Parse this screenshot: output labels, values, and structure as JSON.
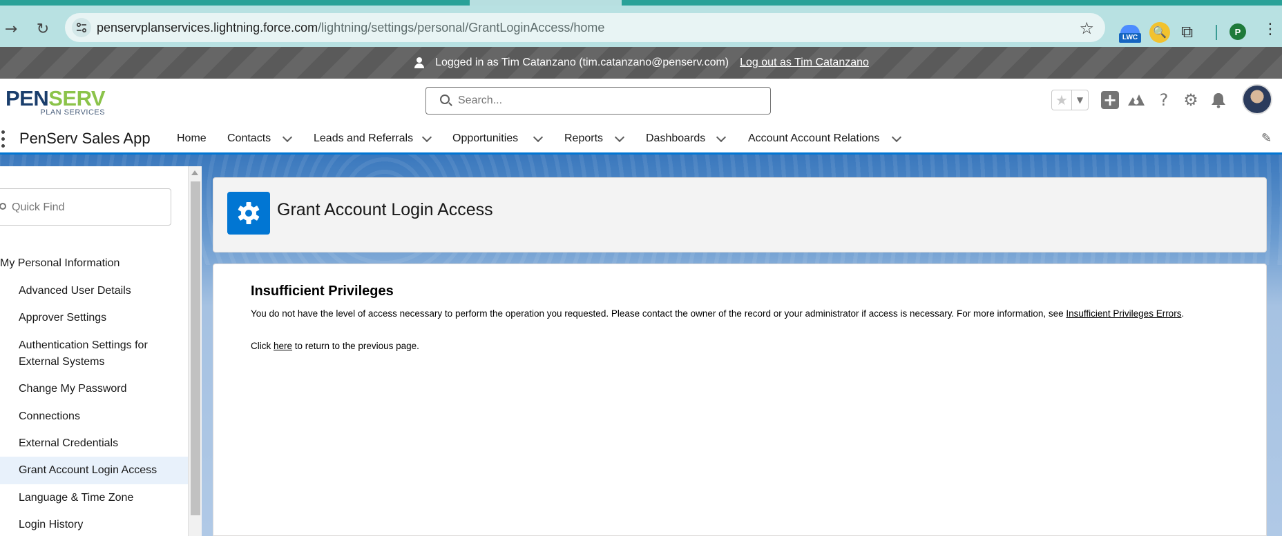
{
  "browser": {
    "url_host": "penservplanservices.lightning.force.com",
    "url_path": "/lightning/settings/personal/GrantLoginAccess/home",
    "extension_lwc_label": "LWC",
    "profile_initial": "P"
  },
  "impersonation": {
    "message": "Logged in as Tim Catanzano (tim.catanzano@penserv.com)",
    "logout_link": "Log out as Tim Catanzano"
  },
  "header": {
    "logo_main_a": "PEN",
    "logo_main_b": "SERV",
    "logo_sub": "PLAN SERVICES",
    "search_placeholder": "Search..."
  },
  "app_nav": {
    "app_name": "PenServ Sales App",
    "items": [
      {
        "label": "Home",
        "has_menu": false
      },
      {
        "label": "Contacts",
        "has_menu": true
      },
      {
        "label": "Leads and Referrals",
        "has_menu": true
      },
      {
        "label": "Opportunities",
        "has_menu": true
      },
      {
        "label": "Reports",
        "has_menu": true
      },
      {
        "label": "Dashboards",
        "has_menu": true
      },
      {
        "label": "Account Account Relations",
        "has_menu": true
      }
    ]
  },
  "sidebar": {
    "quick_find_placeholder": "Quick Find",
    "section": "My Personal Information",
    "items": [
      {
        "label": "Advanced User Details"
      },
      {
        "label": "Approver Settings"
      },
      {
        "label": "Authentication Settings for External Systems"
      },
      {
        "label": "Change My Password"
      },
      {
        "label": "Connections"
      },
      {
        "label": "External Credentials"
      },
      {
        "label": "Grant Account Login Access",
        "active": true
      },
      {
        "label": "Language & Time Zone"
      },
      {
        "label": "Login History"
      }
    ]
  },
  "page": {
    "title": "Grant Account Login Access"
  },
  "error": {
    "title": "Insufficient Privileges",
    "message": "You do not have the level of access necessary to perform the operation you requested. Please contact the owner of the record or your administrator if access is necessary. For more information, see ",
    "link": "Insufficient Privileges Errors",
    "message_end": ".",
    "click_prefix": "Click ",
    "click_link": "here",
    "click_suffix": " to return to the previous page."
  },
  "colors": {
    "brand_blue": "#0176d3",
    "browser_chrome": "#b8e1e2",
    "banner_gray": "#5e5e5e"
  }
}
